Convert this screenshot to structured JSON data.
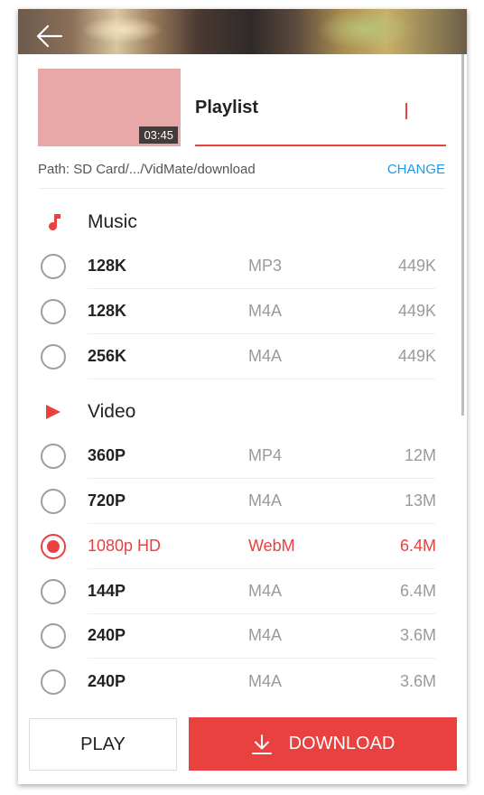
{
  "header": {
    "back_icon": "arrow-left-icon"
  },
  "video": {
    "duration": "03:45",
    "title": "Playlist",
    "path": "Path: SD Card/.../VidMate/download",
    "change_label": "CHANGE"
  },
  "sections": {
    "music": {
      "label": "Music",
      "icon": "music-note-icon"
    },
    "video": {
      "label": "Video",
      "icon": "play-icon"
    }
  },
  "music_options": [
    {
      "quality": "128K",
      "format": "MP3",
      "size": "449K",
      "selected": false
    },
    {
      "quality": "128K",
      "format": "M4A",
      "size": "449K",
      "selected": false
    },
    {
      "quality": "256K",
      "format": "M4A",
      "size": "449K",
      "selected": false
    }
  ],
  "video_options": [
    {
      "quality": "360P",
      "format": "MP4",
      "size": "12M",
      "selected": false
    },
    {
      "quality": "720P",
      "format": "M4A",
      "size": "13M",
      "selected": false
    },
    {
      "quality": "1080p HD",
      "format": "WebM",
      "size": "6.4M",
      "selected": true
    },
    {
      "quality": "144P",
      "format": "M4A",
      "size": "6.4M",
      "selected": false
    },
    {
      "quality": "240P",
      "format": "M4A",
      "size": "3.6M",
      "selected": false
    },
    {
      "quality": "240P",
      "format": "M4A",
      "size": "3.6M",
      "selected": false
    }
  ],
  "actions": {
    "play_label": "PLAY",
    "download_label": "DOWNLOAD",
    "download_icon": "download-icon"
  },
  "colors": {
    "accent": "#e8413f",
    "link": "#1e9be0",
    "muted": "#9a9a9a"
  }
}
